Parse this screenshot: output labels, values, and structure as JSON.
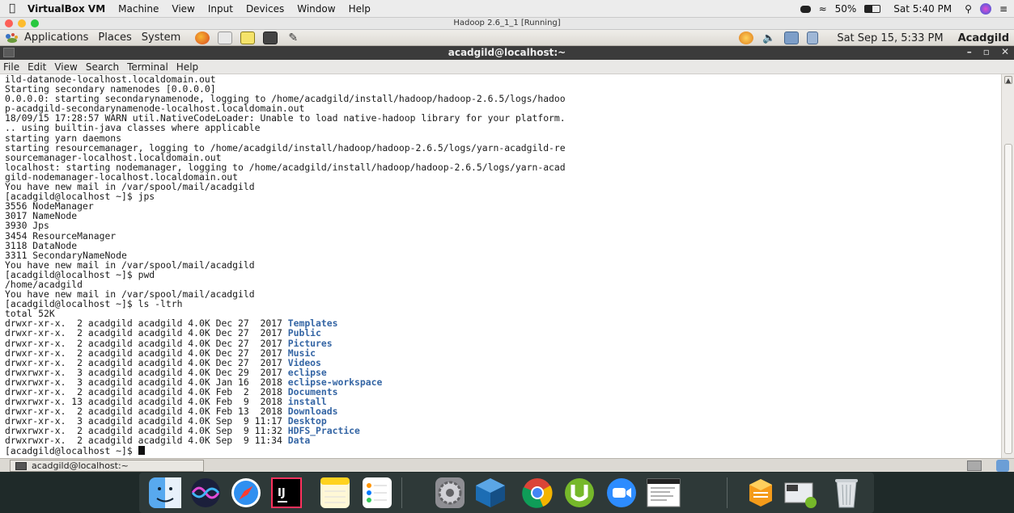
{
  "mac_menubar": {
    "app": "VirtualBox VM",
    "items": [
      "Machine",
      "View",
      "Input",
      "Devices",
      "Window",
      "Help"
    ],
    "battery": "50%",
    "clock": "Sat 5:40 PM"
  },
  "vbox_window": {
    "title": "Hadoop 2.6_1_1 [Running]"
  },
  "gnome_panel": {
    "menus": [
      "Applications",
      "Places",
      "System"
    ],
    "clock": "Sat Sep 15,  5:33 PM",
    "username": "Acadgild"
  },
  "terminal": {
    "title": "acadgild@localhost:~",
    "menu": [
      "File",
      "Edit",
      "View",
      "Search",
      "Terminal",
      "Help"
    ],
    "text_lines": [
      "ild-datanode-localhost.localdomain.out",
      "Starting secondary namenodes [0.0.0.0]",
      "0.0.0.0: starting secondarynamenode, logging to /home/acadgild/install/hadoop/hadoop-2.6.5/logs/hadoo",
      "p-acadgild-secondarynamenode-localhost.localdomain.out",
      "18/09/15 17:28:57 WARN util.NativeCodeLoader: Unable to load native-hadoop library for your platform.",
      ".. using builtin-java classes where applicable",
      "starting yarn daemons",
      "starting resourcemanager, logging to /home/acadgild/install/hadoop/hadoop-2.6.5/logs/yarn-acadgild-re",
      "sourcemanager-localhost.localdomain.out",
      "localhost: starting nodemanager, logging to /home/acadgild/install/hadoop/hadoop-2.6.5/logs/yarn-acad",
      "gild-nodemanager-localhost.localdomain.out",
      "You have new mail in /var/spool/mail/acadgild",
      "[acadgild@localhost ~]$ jps",
      "3556 NodeManager",
      "3017 NameNode",
      "3930 Jps",
      "3454 ResourceManager",
      "3118 DataNode",
      "3311 SecondaryNameNode",
      "You have new mail in /var/spool/mail/acadgild",
      "[acadgild@localhost ~]$ pwd",
      "/home/acadgild",
      "You have new mail in /var/spool/mail/acadgild",
      "[acadgild@localhost ~]$ ls -ltrh",
      "total 52K"
    ],
    "listing": [
      {
        "meta": "drwxr-xr-x.  2 acadgild acadgild 4.0K Dec 27  2017 ",
        "name": "Templates"
      },
      {
        "meta": "drwxr-xr-x.  2 acadgild acadgild 4.0K Dec 27  2017 ",
        "name": "Public"
      },
      {
        "meta": "drwxr-xr-x.  2 acadgild acadgild 4.0K Dec 27  2017 ",
        "name": "Pictures"
      },
      {
        "meta": "drwxr-xr-x.  2 acadgild acadgild 4.0K Dec 27  2017 ",
        "name": "Music"
      },
      {
        "meta": "drwxr-xr-x.  2 acadgild acadgild 4.0K Dec 27  2017 ",
        "name": "Videos"
      },
      {
        "meta": "drwxrwxr-x.  3 acadgild acadgild 4.0K Dec 29  2017 ",
        "name": "eclipse"
      },
      {
        "meta": "drwxrwxr-x.  3 acadgild acadgild 4.0K Jan 16  2018 ",
        "name": "eclipse-workspace"
      },
      {
        "meta": "drwxr-xr-x.  2 acadgild acadgild 4.0K Feb  2  2018 ",
        "name": "Documents"
      },
      {
        "meta": "drwxrwxr-x. 13 acadgild acadgild 4.0K Feb  9  2018 ",
        "name": "install"
      },
      {
        "meta": "drwxr-xr-x.  2 acadgild acadgild 4.0K Feb 13  2018 ",
        "name": "Downloads"
      },
      {
        "meta": "drwxr-xr-x.  3 acadgild acadgild 4.0K Sep  9 11:17 ",
        "name": "Desktop"
      },
      {
        "meta": "drwxrwxr-x.  2 acadgild acadgild 4.0K Sep  9 11:32 ",
        "name": "HDFS_Practice"
      },
      {
        "meta": "drwxrwxr-x.  2 acadgild acadgild 4.0K Sep  9 11:34 ",
        "name": "Data"
      }
    ],
    "prompt": "[acadgild@localhost ~]$ "
  },
  "gnome_bottom": {
    "task_label": "acadgild@localhost:~"
  },
  "dock": {
    "apps": [
      "finder-icon",
      "siri-icon",
      "safari-icon",
      "intellij-icon",
      "notes-icon",
      "reminders-icon",
      "system-preferences-icon",
      "virtualbox-icon",
      "chrome-icon",
      "utorrent-icon",
      "zoom-icon",
      "terminal-preview-icon",
      "sublime-icon",
      "screen-preview-icon",
      "trash-icon"
    ],
    "intellij_label": "IJ"
  },
  "colors": {
    "directory": "#3465a4",
    "terminal_title_bg": "#3b3b3b",
    "dock_bg": "#1f2a29"
  }
}
